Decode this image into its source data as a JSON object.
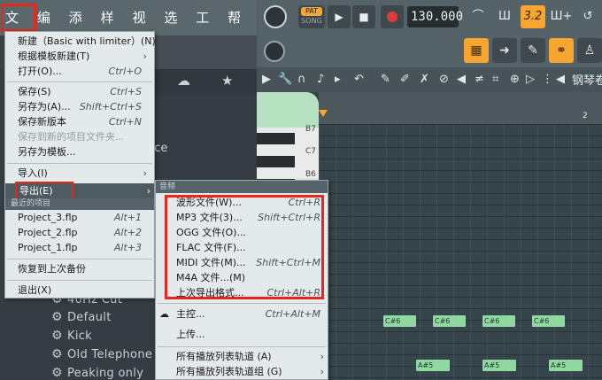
{
  "menubar": {
    "items": [
      "文件",
      "编辑",
      "添加",
      "样式",
      "视图",
      "选项",
      "工具",
      "帮助"
    ]
  },
  "transport": {
    "pat": "PAT",
    "song": "SONG",
    "play_icon": "play-icon",
    "stop_icon": "stop-icon",
    "record_icon": "record-icon",
    "tempo": "130.000",
    "time_display": "3.2",
    "accent_color": "#f6a531"
  },
  "file_menu": {
    "items": [
      {
        "label": "新建（Basic with limiter）(N)",
        "shortcut": ""
      },
      {
        "label": "根据模板新建(T)",
        "shortcut": "",
        "submenu": true
      },
      {
        "label": "打开(O)...",
        "shortcut": "Ctrl+O"
      },
      {
        "label": "保存(S)",
        "shortcut": "Ctrl+S"
      },
      {
        "label": "另存为(A)...",
        "shortcut": "Shift+Ctrl+S"
      },
      {
        "label": "保存新版本",
        "shortcut": "Ctrl+N"
      },
      {
        "label": "保存到新的项目文件夹...",
        "shortcut": "",
        "disabled": true
      },
      {
        "label": "另存为模板...",
        "shortcut": ""
      },
      {
        "label": "导入(I)",
        "shortcut": "",
        "submenu": true
      },
      {
        "label": "导出(E)",
        "shortcut": "",
        "submenu": true,
        "highlighted": true
      },
      {
        "label": "Project_3.flp",
        "shortcut": "Alt+1"
      },
      {
        "label": "Project_2.flp",
        "shortcut": "Alt+2"
      },
      {
        "label": "Project_1.flp",
        "shortcut": "Alt+3"
      },
      {
        "label": "恢复到上次备份",
        "shortcut": ""
      },
      {
        "label": "退出(X)",
        "shortcut": ""
      }
    ],
    "recent_header": "最近的项目"
  },
  "export_menu": {
    "header": "音频",
    "items": [
      {
        "label": "波形文件(W)...",
        "shortcut": "Ctrl+R"
      },
      {
        "label": "MP3 文件(3)...",
        "shortcut": "Shift+Ctrl+R"
      },
      {
        "label": "OGG 文件(O)...",
        "shortcut": ""
      },
      {
        "label": "FLAC 文件(F)...",
        "shortcut": ""
      },
      {
        "label": "MIDI 文件(M)...",
        "shortcut": "Shift+Ctrl+M"
      },
      {
        "label": "M4A 文件...(M)",
        "shortcut": ""
      },
      {
        "label": "上次导出格式...",
        "shortcut": "Ctrl+Alt+R"
      },
      {
        "label": "主控...",
        "shortcut": "Ctrl+Alt+M"
      },
      {
        "label": "上传...",
        "shortcut": ""
      },
      {
        "label": "所有播放列表轨道 (A)",
        "shortcut": "",
        "submenu": true
      },
      {
        "label": "所有播放列表轨道组 (G)",
        "shortcut": "",
        "submenu": true
      }
    ]
  },
  "browser": {
    "fragment": "nce",
    "items": [
      "40Hz Cut",
      "Default",
      "Kick",
      "Old Telephone",
      "Peaking only"
    ]
  },
  "piano_roll": {
    "title": "钢琴卷",
    "ruler_bar": "2",
    "key_labels": [
      "C7",
      "B6"
    ],
    "notes": [
      {
        "label": "C#6"
      },
      {
        "label": "C#6"
      },
      {
        "label": "C#6"
      },
      {
        "label": "C#6"
      },
      {
        "label": "A#5"
      },
      {
        "label": "A#5"
      },
      {
        "label": "A#5"
      }
    ]
  }
}
